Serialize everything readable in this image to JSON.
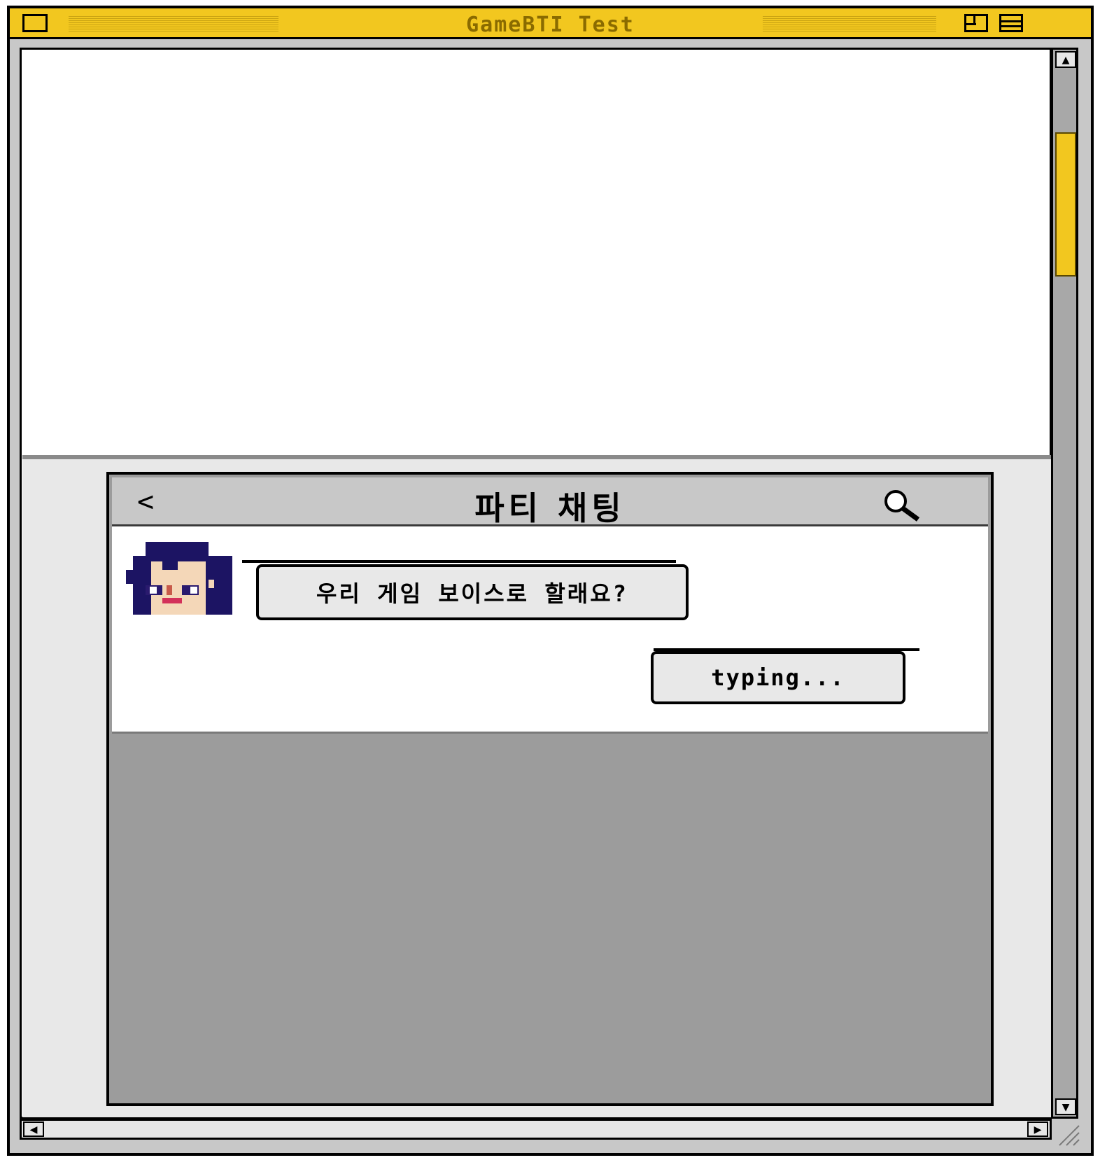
{
  "window": {
    "title": "GameBTI Test"
  },
  "chat": {
    "title": "파티 채팅",
    "back_icon": "chevron-left-icon",
    "search_icon": "search-icon",
    "messages": [
      {
        "from": "other",
        "text": "우리 게임 보이스로 할래요?"
      },
      {
        "from": "me",
        "text": "typing..."
      }
    ]
  },
  "colors": {
    "title_bar": "#f2c71f",
    "scroll_thumb": "#f2c71f",
    "input_area": "#9c9c9c",
    "frame": "#c8c8c8"
  }
}
